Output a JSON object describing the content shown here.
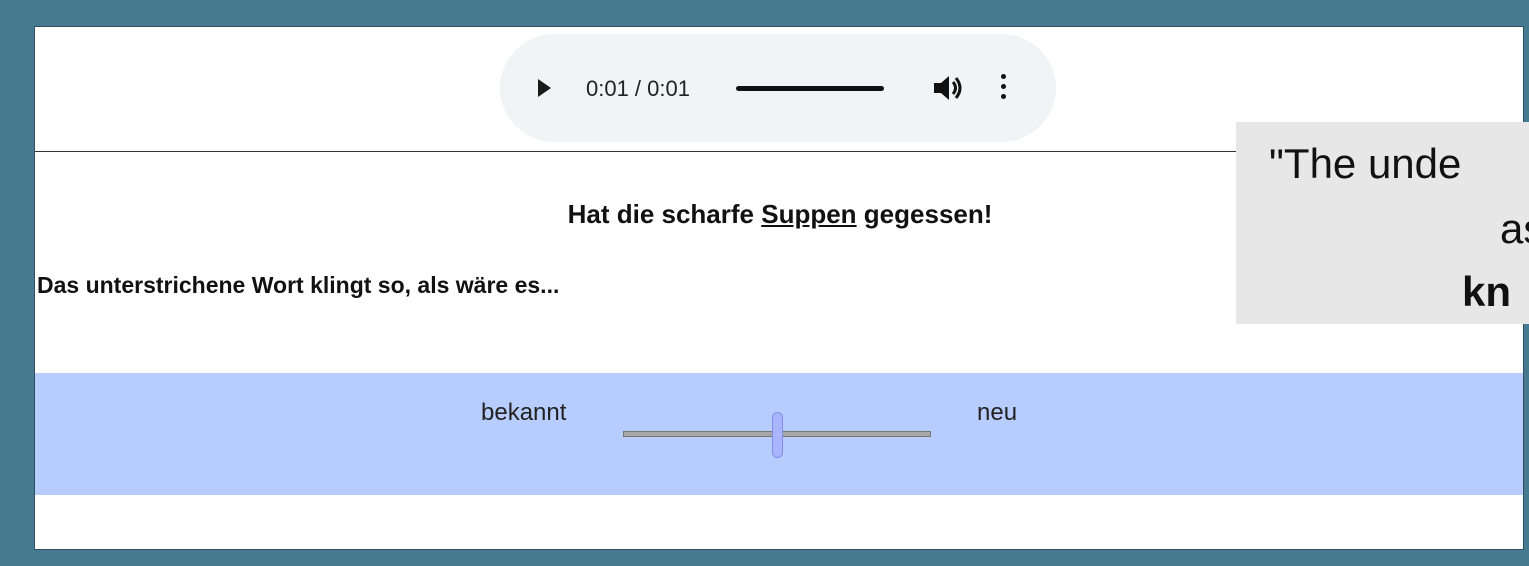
{
  "audio_player": {
    "play_icon": "play-icon",
    "time": "0:01 / 0:01",
    "volume_icon": "volume-icon",
    "more_icon": "more-vert-icon",
    "progress": 1.0
  },
  "sentence": {
    "before": "Hat die scharfe ",
    "underlined": "Suppen",
    "after": " gegessen!"
  },
  "question": "Das unterstrichene Wort klingt so, als wäre es...",
  "rating": {
    "left_label": "bekannt",
    "right_label": "neu",
    "value": 0.5
  },
  "overlay": {
    "line1": "\"The unde",
    "line2": "as",
    "line3": "kn"
  },
  "colors": {
    "background": "#457a91",
    "band": "#b8cdff",
    "slider_thumb": "#a9b6ff"
  }
}
